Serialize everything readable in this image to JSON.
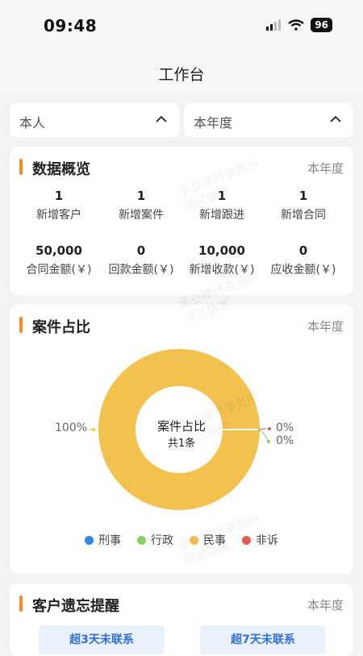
{
  "status_bar": {
    "time": "09:48",
    "battery": "96"
  },
  "header": {
    "title": "工作台"
  },
  "filters": {
    "person": {
      "label": "本人"
    },
    "period": {
      "label": "本年度"
    }
  },
  "overview": {
    "title": "数据概览",
    "period": "本年度",
    "stats": [
      {
        "value": "1",
        "label": "新增客户"
      },
      {
        "value": "1",
        "label": "新增案件"
      },
      {
        "value": "1",
        "label": "新增跟进"
      },
      {
        "value": "1",
        "label": "新增合同"
      },
      {
        "value": "50,000",
        "label": "合同金额(￥)"
      },
      {
        "value": "0",
        "label": "回款金额(￥)"
      },
      {
        "value": "10,000",
        "label": "新增收款(￥)"
      },
      {
        "value": "0",
        "label": "应收金额(￥)"
      }
    ]
  },
  "case_ratio": {
    "title": "案件占比",
    "period": "本年度",
    "center_title": "案件占比",
    "center_sub": "共1条",
    "percent_labels": [
      "100%",
      "0%",
      "0%"
    ],
    "legend": [
      {
        "label": "刑事",
        "color": "#2a8ae5"
      },
      {
        "label": "行政",
        "color": "#8ccf6a"
      },
      {
        "label": "民事",
        "color": "#f2c14e"
      },
      {
        "label": "非诉",
        "color": "#e25c4f"
      }
    ]
  },
  "chart_data": {
    "type": "pie",
    "title": "案件占比",
    "categories": [
      "刑事",
      "行政",
      "民事",
      "非诉"
    ],
    "values": [
      0,
      0,
      100,
      0
    ],
    "colors": [
      "#2a8ae5",
      "#8ccf6a",
      "#f2c14e",
      "#e25c4f"
    ]
  },
  "reminders": {
    "title": "客户遗忘提醒",
    "period": "本年度",
    "buttons": [
      "超3天未联系",
      "超7天未联系"
    ]
  },
  "watermark": {
    "line1": "承业律师事务所",
    "line2": "测试销售"
  }
}
